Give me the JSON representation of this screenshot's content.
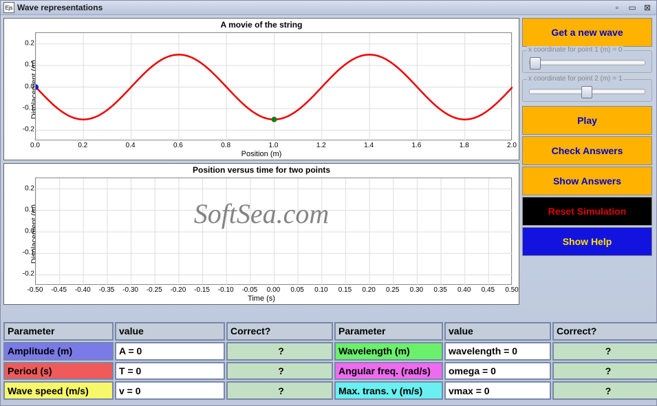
{
  "window_title": "Wave representations",
  "buttons": {
    "new_wave": "Get a new wave",
    "play": "Play",
    "check": "Check Answers",
    "show": "Show Answers",
    "reset": "Reset Simulation",
    "help": "Show Help"
  },
  "sliders": {
    "p1": {
      "label": "x coordinate for point 1 (m) = 0",
      "pos": 0.0
    },
    "p2": {
      "label": "x coordinate for point 2 (m) = 1",
      "pos": 0.5
    }
  },
  "headers": {
    "param": "Parameter",
    "value": "value",
    "correct": "Correct?"
  },
  "rows_left": [
    {
      "name": "Amplitude (m)",
      "value": "A = 0",
      "correct": "?"
    },
    {
      "name": "Period (s)",
      "value": "T = 0",
      "correct": "?"
    },
    {
      "name": "Wave speed (m/s)",
      "value": "v = 0",
      "correct": "?"
    }
  ],
  "rows_right": [
    {
      "name": "Wavelength (m)",
      "value": "wavelength = 0",
      "correct": "?"
    },
    {
      "name": "Angular freq. (rad/s)",
      "value": "omega = 0",
      "correct": "?"
    },
    {
      "name": "Max. trans. v (m/s)",
      "value": "vmax = 0",
      "correct": "?"
    }
  ],
  "watermark": "SoftSea.com",
  "chart_data": [
    {
      "type": "line",
      "title": "A movie of the string",
      "xlabel": "Position (m)",
      "ylabel": "Displacement (m)",
      "xlim": [
        0.0,
        2.0
      ],
      "ylim": [
        -0.25,
        0.25
      ],
      "xticks": [
        0.0,
        0.2,
        0.4,
        0.6,
        0.8,
        1.0,
        1.2,
        1.4,
        1.6,
        1.8,
        2.0
      ],
      "yticks": [
        -0.2,
        -0.1,
        0.0,
        0.1,
        0.2
      ],
      "series": [
        {
          "name": "string",
          "function": "0.15 * sin(2*pi*x/0.8 + pi)",
          "amplitude": 0.15,
          "wavelength": 0.8,
          "phase_deg": 180,
          "color": "#e00000"
        }
      ],
      "markers": [
        {
          "x": 0.0,
          "y": 0.0,
          "color": "#1515e0"
        },
        {
          "x": 1.0,
          "y": -0.15,
          "color": "#108010"
        }
      ]
    },
    {
      "type": "line",
      "title": "Position versus time for two points",
      "xlabel": "Time (s)",
      "ylabel": "Displacement (m)",
      "xlim": [
        -0.5,
        0.5
      ],
      "ylim": [
        -0.25,
        0.25
      ],
      "xticks": [
        -0.5,
        -0.45,
        -0.4,
        -0.35,
        -0.3,
        -0.25,
        -0.2,
        -0.15,
        -0.1,
        -0.05,
        -0.0,
        0.05,
        0.1,
        0.15,
        0.2,
        0.25,
        0.3,
        0.35,
        0.4,
        0.45,
        0.5
      ],
      "yticks": [
        -0.2,
        -0.1,
        0.0,
        0.1,
        0.2
      ],
      "series": []
    }
  ]
}
